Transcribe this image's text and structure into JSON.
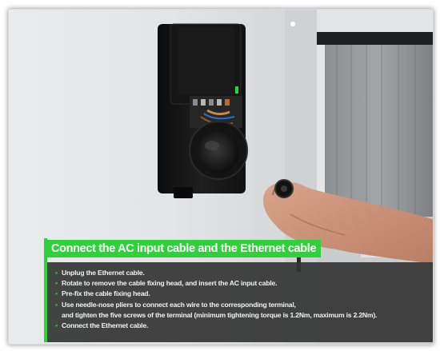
{
  "caption": {
    "title": "Connect the AC input cable and the Ethernet cable",
    "steps": [
      "Unplug the Ethernet cable.",
      "Rotate to remove the cable fixing head, and insert the AC input cable.",
      "Pre-fix the cable fixing head.",
      "Use needle-nose pliers to connect each wire to the corresponding terminal,",
      "and tighten the five screws of the terminal (minimum tightening torque is 1.2Nm, maximum is 2.2Nm).",
      "Connect the Ethernet cable."
    ]
  },
  "colors": {
    "accent": "#2fd13a",
    "panel": "#343434",
    "charger_body": "#141414",
    "wall": "#e4e6e7"
  },
  "icons": {
    "bullet": "•"
  }
}
